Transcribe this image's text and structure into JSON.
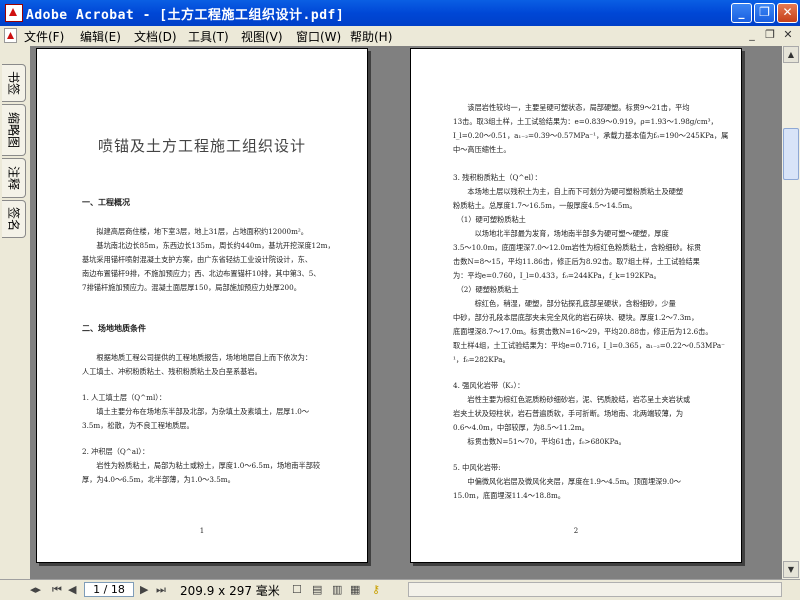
{
  "window": {
    "title": "Adobe Acrobat - [土方工程施工组织设计.pdf]",
    "minimize_label": "_",
    "maximize_label": "❐",
    "close_label": "✕"
  },
  "menu": {
    "items": [
      "文件(F)",
      "编辑(E)",
      "文档(D)",
      "工具(T)",
      "视图(V)",
      "窗口(W)",
      "帮助(H)"
    ],
    "right_minimize": "_",
    "right_restore": "❐",
    "right_close": "✕"
  },
  "sidetabs": [
    "书签",
    "缩略图",
    "注释",
    "签名"
  ],
  "page_left": {
    "title": "喷锚及土方工程施工组织设计",
    "section1": "一、工程概况",
    "s1_lines": [
      "　　拟建高层商住楼，地下室3层，地上31层，占地面积约12000m²。",
      "　　基坑南北边长85m，东西边长135m，周长约440m，基坑开挖深度12m，",
      "基坑采用锚杆喷射混凝土支护方案，由广东省轻纺工业设计院设计，东、",
      "南边布置锚杆9排，不施加预应力；西、北边布置锚杆10排，其中第3、5、",
      "7排锚杆施加预应力。混凝土面层厚150，局部施加预应力处厚200。"
    ],
    "section2": "二、场地地质条件",
    "s2_lines": [
      "　　根据地质工程公司提供的工程地质报告，场地地层自上而下依次为：",
      "人工填土、冲积粉质粘土、残积粉质粘土及白垩系基岩。"
    ],
    "sub1": "1. 人工填土层（Q^ml）：",
    "sub1_lines": [
      "　　填土主要分布在场地东半部及北部，为杂填土及素填土，层厚1.0～",
      "3.5m，松散，为不良工程地质层。"
    ],
    "sub2": "2. 冲积层（Q^al）：",
    "sub2_lines": [
      "　　岩性为粉质粘土，局部为粘土或粉土，厚度1.0～6.5m，场地南半部较",
      "厚，为4.0～6.5m，北半部薄，为1.0～3.5m。"
    ],
    "page_number": "1"
  },
  "page_right": {
    "lines_a": [
      "　　该层岩性较均一，主要呈硬可塑状态，局部硬塑。标贯9～21击，平均",
      "13击。取3组土样，土工试验结果为：e=0.839～0.919，ρ=1.93～1.98g/cm³，",
      "I_l=0.20～0.51，a₁₋₂=0.39～0.57MPa⁻¹，承载力基本值为f₀=190～245KPa，属",
      "中～高压缩性土。"
    ],
    "sub3": "3. 残积粉质粘土（Q^el）：",
    "lines_b": [
      "　　本场地土层以残积土为主，自上而下可划分为硬可塑粉质粘土及硬塑",
      "粉质粘土。总厚度1.7～16.5m，一般厚度4.5～14.5m。"
    ],
    "sub3_1": "　（1）硬可塑粉质粘土",
    "lines_c": [
      "　　　以场地北半部最为发育，场地南半部多为硬可塑～硬塑，厚度",
      "3.5～10.0m，底面埋深7.0～12.0m岩性为棕红色粉质粘土，含粉细砂。标贯",
      "击数N=8～15，平均11.86击，修正后为8.92击。取7组土样，土工试验结果",
      "为：平均e=0.760，I_l=0.433，f₀=244KPa，f_k=192KPa。"
    ],
    "sub3_2": "　（2）硬塑粉质粘土",
    "lines_d": [
      "　　　棕红色，稍湿，硬塑，部分钻探孔底部呈硬状，含粉细砂，少量",
      "中砂，部分孔段本层底部夹未完全风化的岩石碎块、硬块。厚度1.2～7.3m，",
      "底面埋深8.7～17.0m。标贯击数N=16～29，平均20.88击，修正后为12.6击。",
      "取土样4组，土工试验结果为：平均e=0.716，I_l=0.365，a₁₋₂=0.22～0.53MPa⁻",
      "¹，f₀=282KPa。"
    ],
    "sub4": "4. 强风化岩带（K₂）：",
    "lines_e": [
      "　　岩性主要为棕红色泥质粉砂细砂岩，泥、钙质胶结，岩芯呈土夹岩状或",
      "岩夹土状及短柱状，岩石普遍质软，手可折断。场地南、北两端较薄，为",
      "0.6～4.0m，中部较厚，为8.5～11.2m。",
      "　　标贯击数N=51～70，平均61击，f₀>680KPa。"
    ],
    "sub5": "5. 中风化岩带:",
    "lines_f": [
      "　　中偏微风化岩层及微风化夹层，厚度在1.9～4.5m。顶面埋深9.0～",
      "15.0m，底面埋深11.4～18.8m。"
    ],
    "page_number": "2"
  },
  "status": {
    "page_display": "1 / 18",
    "page_size": "209.9 x 297 毫米"
  }
}
